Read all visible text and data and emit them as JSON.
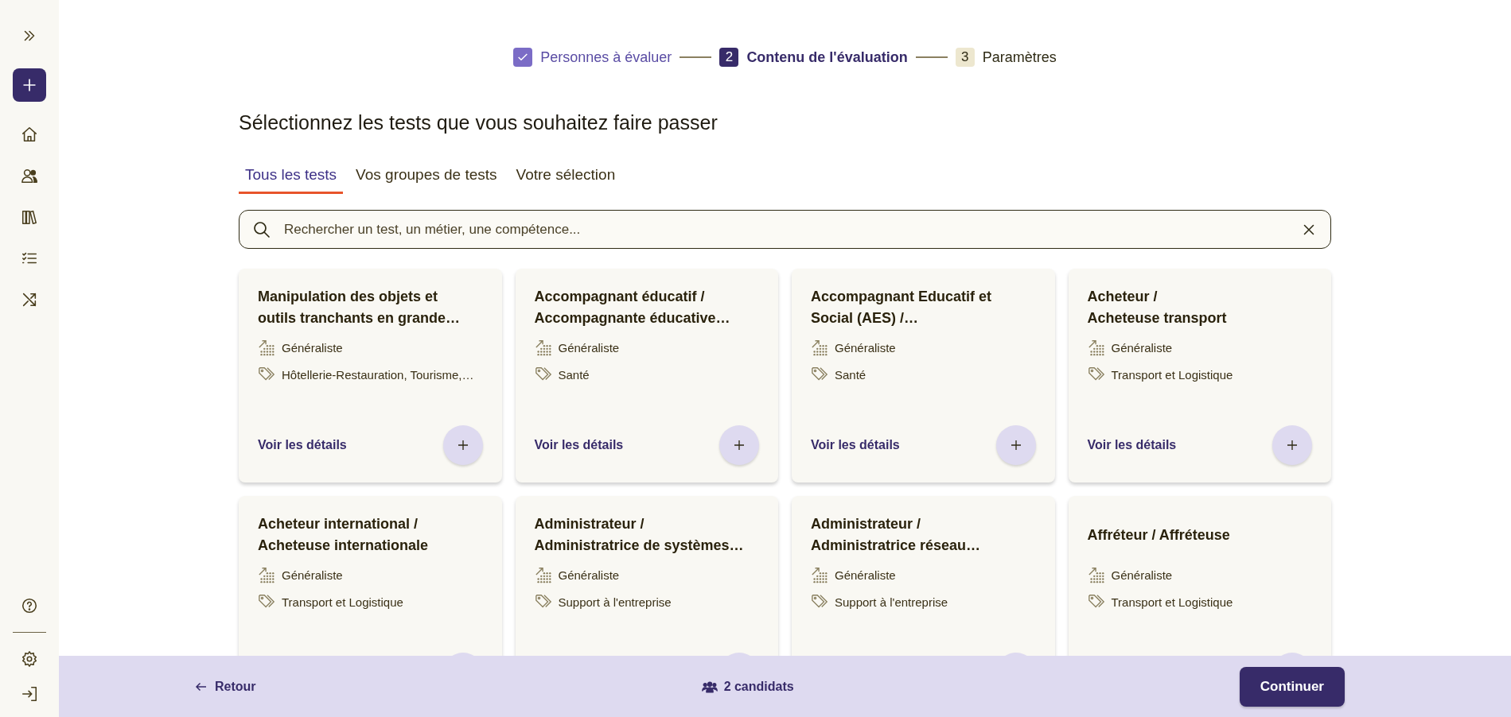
{
  "steps": [
    {
      "kind": "done",
      "label": "Personnes à évaluer"
    },
    {
      "kind": "current",
      "number": "2",
      "label": "Contenu de l'évaluation"
    },
    {
      "kind": "upcoming",
      "number": "3",
      "label": "Paramètres"
    }
  ],
  "heading": "Sélectionnez les tests que vous souhaitez faire passer",
  "tabs": [
    {
      "label": "Tous les tests",
      "selected": true
    },
    {
      "label": "Vos groupes de tests",
      "selected": false
    },
    {
      "label": "Votre sélection",
      "selected": false
    }
  ],
  "search": {
    "placeholder": "Rechercher un test, un métier, une compétence..."
  },
  "cards": [
    {
      "title": [
        "Manipulation des objets et",
        "outils tranchants en grande…"
      ],
      "level": "Généraliste",
      "sector": "Hôtellerie-Restauration, Tourisme,…",
      "link": "Voir les détails"
    },
    {
      "title": [
        "Accompagnant éducatif /",
        "Accompagnante éducative…"
      ],
      "level": "Généraliste",
      "sector": "Santé",
      "link": "Voir les détails"
    },
    {
      "title": [
        "Accompagnant Educatif et",
        "Social (AES) /…"
      ],
      "level": "Généraliste",
      "sector": "Santé",
      "link": "Voir les détails"
    },
    {
      "title": [
        "Acheteur /",
        "Acheteuse transport"
      ],
      "level": "Généraliste",
      "sector": "Transport et Logistique",
      "link": "Voir les détails"
    },
    {
      "title": [
        "Acheteur international /",
        "Acheteuse internationale"
      ],
      "level": "Généraliste",
      "sector": "Transport et Logistique"
    },
    {
      "title": [
        "Administrateur /",
        "Administratrice de systèmes…"
      ],
      "level": "Généraliste",
      "sector": "Support à l'entreprise"
    },
    {
      "title": [
        "Administrateur /",
        "Administratrice réseau…"
      ],
      "level": "Généraliste",
      "sector": "Support à l'entreprise"
    },
    {
      "title": [
        "Affréteur / Affréteuse"
      ],
      "level": "Généraliste",
      "sector": "Transport et Logistique"
    }
  ],
  "footer": {
    "back": "Retour",
    "candidates": "2 candidats",
    "continue": "Continuer"
  }
}
